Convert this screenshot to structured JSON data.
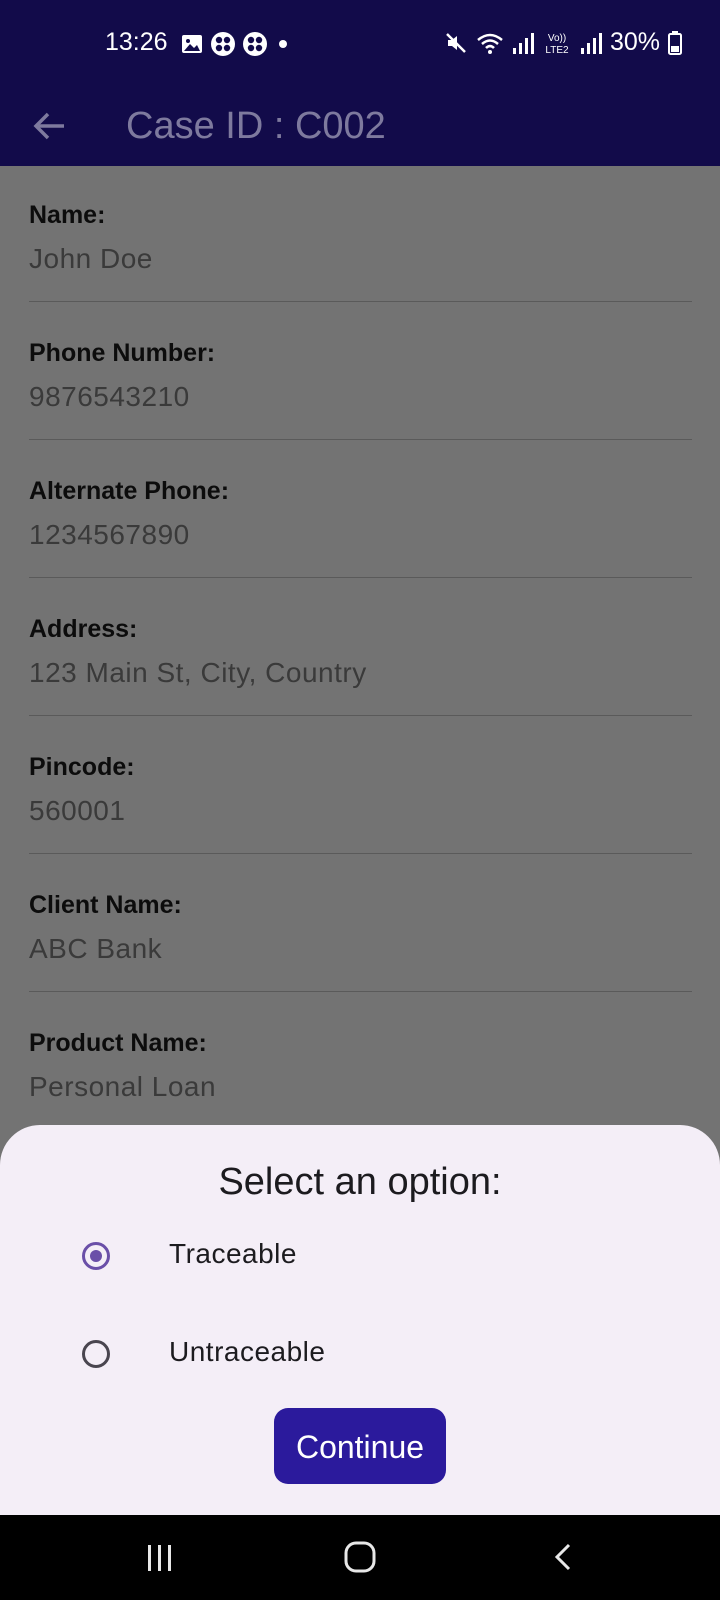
{
  "status_bar": {
    "time": "13:26",
    "battery": "30%",
    "notification_icons": [
      "image-icon",
      "game-icon",
      "game-icon",
      "dot-icon"
    ],
    "system_icons": [
      "mute-icon",
      "wifi-icon",
      "signal-icon",
      "volte-icon",
      "signal-icon",
      "battery-icon"
    ]
  },
  "app_bar": {
    "title": "Case ID : C002"
  },
  "fields": [
    {
      "label": "Name:",
      "value": "John Doe"
    },
    {
      "label": "Phone Number:",
      "value": "9876543210"
    },
    {
      "label": "Alternate Phone:",
      "value": "1234567890"
    },
    {
      "label": "Address:",
      "value": "123 Main St, City, Country"
    },
    {
      "label": "Pincode:",
      "value": "560001"
    },
    {
      "label": "Client Name:",
      "value": "ABC Bank"
    },
    {
      "label": "Product Name:",
      "value": "Personal Loan"
    }
  ],
  "sheet": {
    "title": "Select an option:",
    "options": [
      {
        "label": "Traceable",
        "selected": true
      },
      {
        "label": "Untraceable",
        "selected": false
      }
    ],
    "continue_label": "Continue"
  },
  "colors": {
    "app_bar": "#120b4a",
    "primary_button": "#2b1a9c",
    "radio_selected": "#6a4fa8",
    "sheet_bg": "#f4eef7",
    "scrim": "#737373"
  }
}
